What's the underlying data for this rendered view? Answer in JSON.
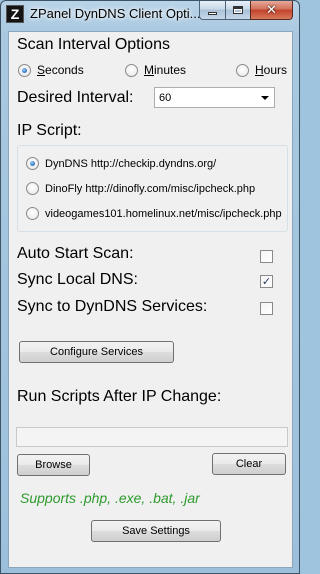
{
  "window": {
    "title": "ZPanel DynDNS Client Opti...",
    "app_icon_glyph": "Z"
  },
  "scan_interval": {
    "title": "Scan Interval Options",
    "options": [
      {
        "label": "Seconds",
        "checked": true
      },
      {
        "label": "Minutes",
        "checked": false
      },
      {
        "label": "Hours",
        "checked": false
      }
    ]
  },
  "desired_interval": {
    "label": "Desired Interval:",
    "value": "60"
  },
  "ip_script": {
    "title": "IP Script:",
    "options": [
      {
        "label": "DynDNS http://checkip.dyndns.org/",
        "checked": true
      },
      {
        "label": "DinoFly http://dinofly.com/misc/ipcheck.php",
        "checked": false
      },
      {
        "label": "videogames101.homelinux.net/misc/ipcheck.php",
        "checked": false
      }
    ]
  },
  "toggles": {
    "auto_start": {
      "label": "Auto Start Scan:",
      "checked": false
    },
    "sync_local": {
      "label": "Sync Local DNS:",
      "checked": true
    },
    "sync_dyndns": {
      "label": "Sync to DynDNS Services:",
      "checked": false
    }
  },
  "buttons": {
    "configure": "Configure Services",
    "browse": "Browse",
    "clear": "Clear",
    "save": "Save Settings"
  },
  "run_scripts": {
    "label": "Run Scripts After IP Change:",
    "path_value": ""
  },
  "supports_text": "Supports .php, .exe, .bat, .jar",
  "colors": {
    "supports_green": "#2d9a2d",
    "radio_blue": "#2a6fb8",
    "check_mark": "#2a3c62"
  }
}
